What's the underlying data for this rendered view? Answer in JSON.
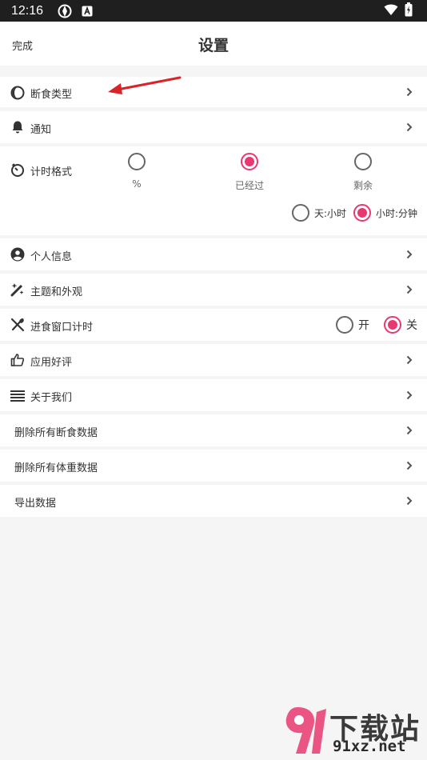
{
  "status_bar": {
    "time": "12:16",
    "icons": [
      "vpn-icon",
      "a-notification-icon",
      "wifi-icon",
      "battery-icon"
    ]
  },
  "header": {
    "done_label": "完成",
    "title": "设置"
  },
  "accent_color": "#e8386f",
  "settings": {
    "fasting_type": {
      "label": "断食类型",
      "icon": "half-circle-icon"
    },
    "notifications": {
      "label": "通知",
      "icon": "bell-icon"
    },
    "timer_format": {
      "label": "计时格式",
      "icon": "timer-icon",
      "options": [
        {
          "label": "%",
          "selected": false
        },
        {
          "label": "已经过",
          "selected": true
        },
        {
          "label": "剩余",
          "selected": false
        }
      ],
      "unit_options": [
        {
          "label": "天:小时",
          "selected": false
        },
        {
          "label": "小时:分钟",
          "selected": true
        }
      ]
    },
    "profile": {
      "label": "个人信息",
      "icon": "person-icon"
    },
    "theme": {
      "label": "主题和外观",
      "icon": "magic-wand-icon"
    },
    "eating_window": {
      "label": "进食窗口计时",
      "icon": "fork-spoon-icon",
      "on_label": "开",
      "off_label": "关",
      "value": "off"
    },
    "rate_app": {
      "label": "应用好评",
      "icon": "thumbs-up-icon"
    },
    "about": {
      "label": "关于我们",
      "icon": "lines-icon"
    },
    "delete_fasting": {
      "label": "删除所有断食数据"
    },
    "delete_weight": {
      "label": "删除所有体重数据"
    },
    "export": {
      "label": "导出数据"
    }
  },
  "watermark": {
    "logo_text": "下载站",
    "domain_text": "91xz.net"
  }
}
